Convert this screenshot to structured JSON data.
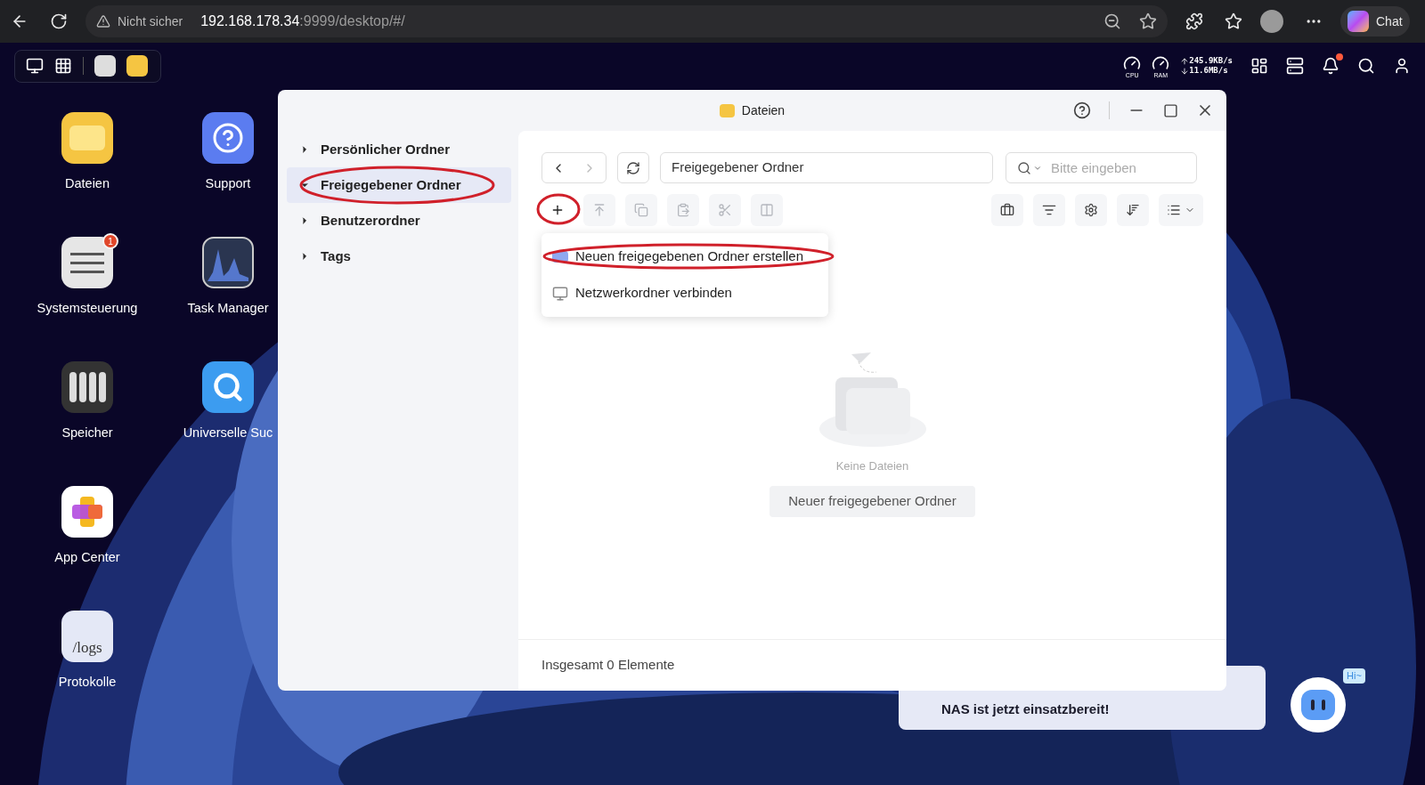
{
  "browser": {
    "security": "Nicht sicher",
    "url_host": "192.168.178.34",
    "url_rest": ":9999/desktop/#/",
    "chat": "Chat"
  },
  "taskbar": {
    "cpu": "CPU",
    "ram": "RAM",
    "upload": "245.9KB/s",
    "download": "11.6MB/s",
    "notification_dot": true
  },
  "desktop_icons": [
    {
      "label": "Dateien",
      "kind": "files"
    },
    {
      "label": "Systemsteuerung",
      "kind": "settings",
      "badge": "1"
    },
    {
      "label": "Speicher",
      "kind": "storage"
    },
    {
      "label": "App Center",
      "kind": "appcenter"
    },
    {
      "label": "Protokolle",
      "kind": "logs",
      "icon_text": "/logs"
    },
    {
      "label": "Support",
      "kind": "support"
    },
    {
      "label": "Task Manager",
      "kind": "taskmanager"
    },
    {
      "label": "Universelle Suc",
      "kind": "search"
    }
  ],
  "window": {
    "title": "Dateien",
    "sidebar": [
      {
        "label": "Persönlicher Ordner",
        "expanded": false,
        "selected": false
      },
      {
        "label": "Freigegebener Ordner",
        "expanded": true,
        "selected": true
      },
      {
        "label": "Benutzerordner",
        "expanded": false,
        "selected": false
      },
      {
        "label": "Tags",
        "expanded": false,
        "selected": false
      }
    ],
    "path": "Freigegebener Ordner",
    "search": {
      "placeholder": "Bitte eingeben"
    },
    "toolbar_left": [
      {
        "kind": "add",
        "disabled": false
      },
      {
        "kind": "upload",
        "disabled": true
      },
      {
        "kind": "copy",
        "disabled": true
      },
      {
        "kind": "paste",
        "disabled": true
      },
      {
        "kind": "cut",
        "disabled": true
      },
      {
        "kind": "rename",
        "disabled": true
      }
    ],
    "toolbar_right": [
      {
        "kind": "briefcase"
      },
      {
        "kind": "filter"
      },
      {
        "kind": "settings"
      },
      {
        "kind": "sort"
      },
      {
        "kind": "view"
      }
    ],
    "add_menu": [
      {
        "label": "Neuen freigegebenen Ordner erstellen",
        "kind": "shared"
      },
      {
        "label": "Netzwerkordner verbinden",
        "kind": "network"
      }
    ],
    "empty_text": "Keine Dateien",
    "empty_button": "Neuer freigegebener Ordner",
    "status": "Insgesamt 0 Elemente"
  },
  "toast": {
    "text": "NAS ist jetzt einsatzbereit!"
  },
  "assistant": {
    "bubble": "Hi~"
  }
}
